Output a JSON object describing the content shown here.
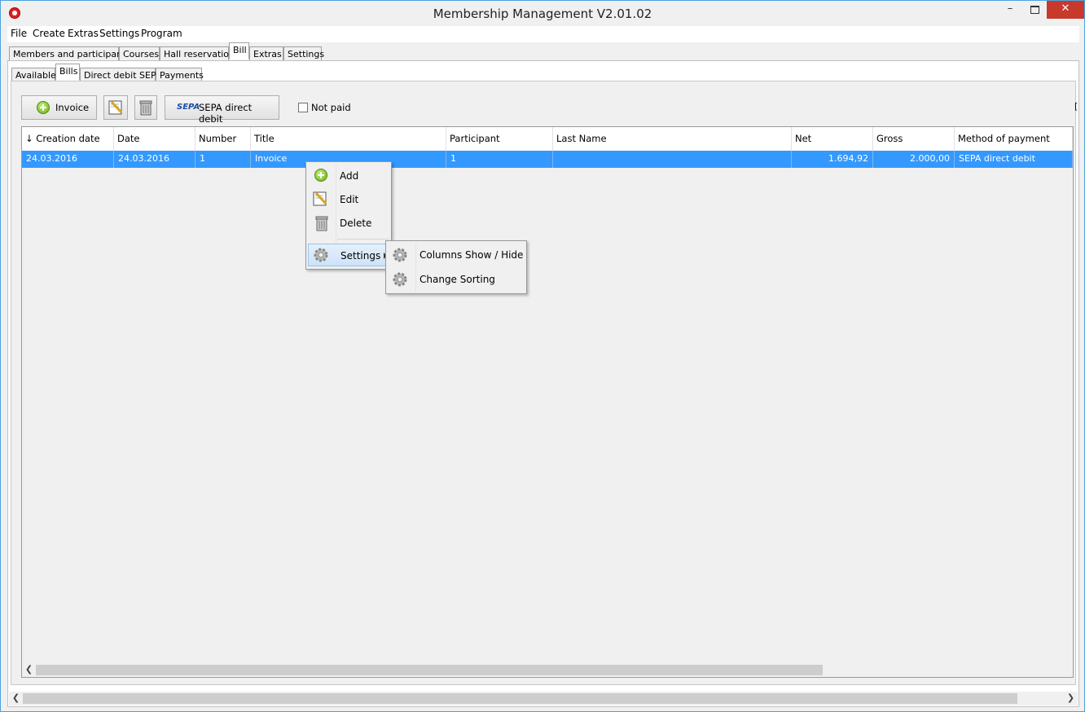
{
  "window": {
    "title": "Membership Management V2.01.02"
  },
  "menubar": [
    "File",
    "Create",
    "Extras",
    "Settings",
    "Program"
  ],
  "main_tabs": [
    "Members and participants",
    "Courses",
    "Hall reservation",
    "Bill",
    "Extras",
    "Settings"
  ],
  "sub_tabs": [
    "Available",
    "Bills",
    "Direct debit SEPA",
    "Payments"
  ],
  "toolbar": {
    "invoice_label": "Invoice",
    "sepa_logo": "SEPA",
    "sepa_label": "SEPA direct debit",
    "not_paid_label": "Not paid",
    "not_paid_checked": false
  },
  "table": {
    "columns": [
      "↓ Creation date",
      "Date",
      "Number",
      "Title",
      "Participant",
      "Last Name",
      "Net",
      "Gross",
      "Method of payment"
    ],
    "rows": [
      [
        "24.03.2016",
        "24.03.2016",
        "1",
        "Invoice",
        "1",
        "",
        "1.694,92",
        "2.000,00",
        "SEPA direct debit"
      ]
    ]
  },
  "context_menu": {
    "items": [
      "Add",
      "Edit",
      "Delete",
      "Settings"
    ],
    "submenu": [
      "Columns Show / Hide",
      "Change Sorting"
    ]
  },
  "colors": {
    "selection": "#3399ff",
    "title_close": "#c7392c"
  }
}
